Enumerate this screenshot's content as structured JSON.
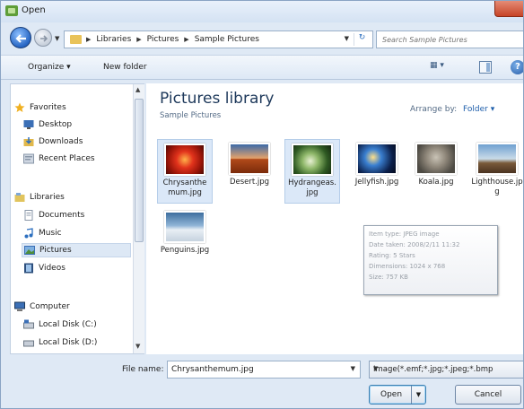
{
  "window": {
    "title": "Open"
  },
  "address": {
    "crumbs": [
      "Libraries",
      "Pictures",
      "Sample Pictures"
    ],
    "search_placeholder": "Search Sample Pictures"
  },
  "toolbar": {
    "organize": "Organize ▾",
    "new_folder": "New folder"
  },
  "nav": {
    "favorites": "Favorites",
    "desktop": "Desktop",
    "downloads": "Downloads",
    "recent": "Recent Places",
    "libraries": "Libraries",
    "documents": "Documents",
    "music": "Music",
    "pictures": "Pictures",
    "videos": "Videos",
    "computer": "Computer",
    "local_c": "Local Disk (C:)",
    "local_d": "Local Disk (D:)"
  },
  "library": {
    "title": "Pictures library",
    "subtitle": "Sample Pictures",
    "arrange_label": "Arrange by:",
    "arrange_value": "Folder ▾"
  },
  "files": [
    {
      "name": "Chrysanthemum.jpg",
      "selected": true
    },
    {
      "name": "Desert.jpg",
      "selected": false
    },
    {
      "name": "Hydrangeas.jpg",
      "selected": true
    },
    {
      "name": "Jellyfish.jpg",
      "selected": false
    },
    {
      "name": "Koala.jpg",
      "selected": false
    },
    {
      "name": "Lighthouse.jpg",
      "selected": false
    },
    {
      "name": "Penguins.jpg",
      "selected": false
    }
  ],
  "tooltip": {
    "item_type": "Item type: JPEG image",
    "date_taken": "Date taken: 2008/2/11 11:32",
    "rating": "Rating: 5 Stars",
    "dimensions": "Dimensions: 1024 x 768",
    "size": "Size: 757 KB"
  },
  "bottom": {
    "file_name_label": "File name:",
    "file_name_value": "Chrysanthemum.jpg",
    "file_type": "Image(*.emf;*.jpg;*.jpeg;*.bmp",
    "open": "Open",
    "cancel": "Cancel"
  }
}
